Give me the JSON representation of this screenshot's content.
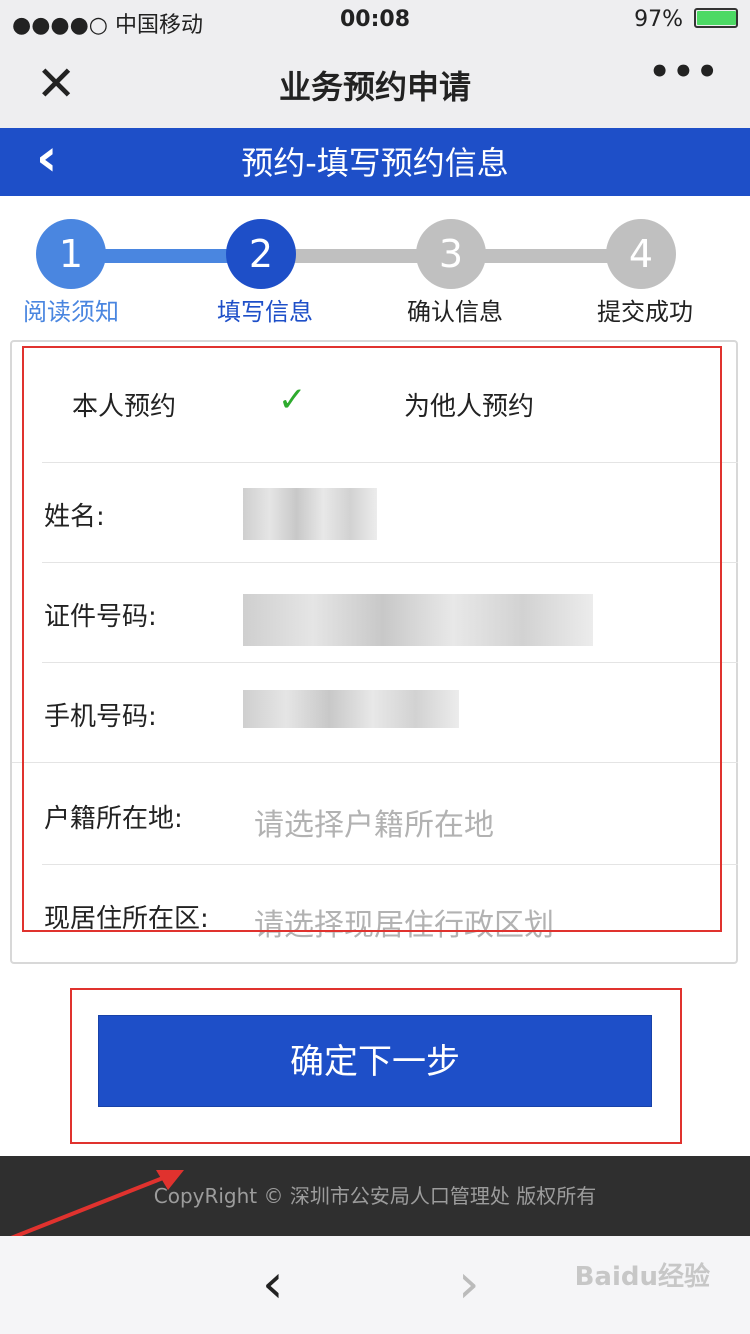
{
  "status_bar": {
    "carrier": "●●●●○ 中国移动",
    "time": "00:08",
    "battery": "97%",
    "battery_level": 0.97
  },
  "nav": {
    "title": "业务预约申请",
    "close_icon": "✕",
    "more_icon": "•••"
  },
  "header": {
    "title": "预约-填写预约信息",
    "back_icon": "‹"
  },
  "steps": [
    {
      "number": "1",
      "label": "阅读须知"
    },
    {
      "number": "2",
      "label": "填写信息"
    },
    {
      "number": "3",
      "label": "确认信息"
    },
    {
      "number": "4",
      "label": "提交成功"
    }
  ],
  "colors": {
    "accent": "#1e4fc8",
    "step_done": "#4a86e0",
    "step_pending": "#c0c0c0",
    "check": "#2eab2e",
    "highlight": "#e0322e"
  },
  "form": {
    "self_option": "本人预约",
    "check_icon": "✓",
    "other_option": "为他人预约",
    "name_label": "姓名:",
    "id_label": "证件号码:",
    "phone_label": "手机号码:",
    "household_label": "户籍所在地:",
    "household_placeholder": "请选择户籍所在地",
    "residence_label": "现居住所在区:",
    "residence_placeholder": "请选择现居住行政区划"
  },
  "next_button": "确定下一步",
  "footer": "CopyRight © 深圳市公安局人口管理处 版权所有",
  "bottom_nav": {
    "prev_icon": "‹",
    "next_icon": "›"
  },
  "watermark": "Baidu经验"
}
